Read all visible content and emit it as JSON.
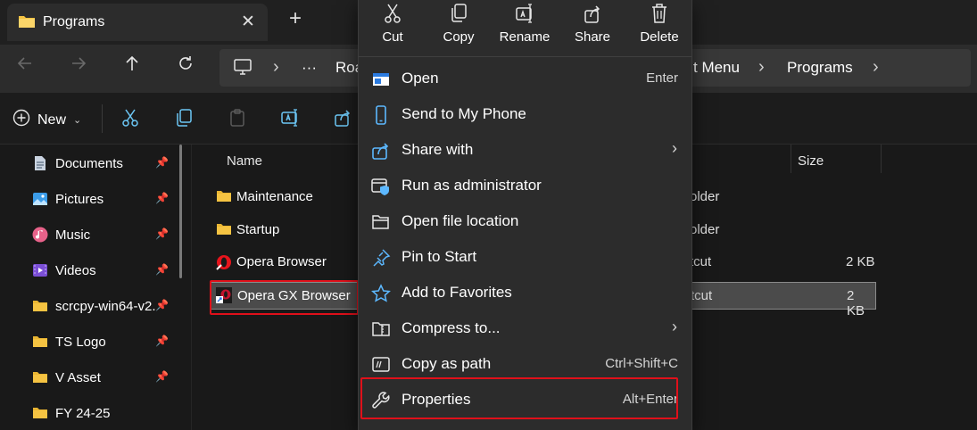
{
  "window": {
    "tab_title": "Programs",
    "tab_close": "✕",
    "new_tab": "+"
  },
  "address_bar": {
    "more": "···",
    "crumb_partial_left": "Roa",
    "crumb_partial_right": "t Menu",
    "crumb_current": "Programs",
    "separator": "›"
  },
  "command_bar": {
    "new_label": "New",
    "new_icon": "plus-circle-icon"
  },
  "sidebar": {
    "items": [
      {
        "label": "Documents",
        "icon": "documents-icon",
        "pinned": true
      },
      {
        "label": "Pictures",
        "icon": "pictures-icon",
        "pinned": true
      },
      {
        "label": "Music",
        "icon": "music-icon",
        "pinned": true
      },
      {
        "label": "Videos",
        "icon": "videos-icon",
        "pinned": true
      },
      {
        "label": "scrcpy-win64-v2.",
        "icon": "folder-icon",
        "pinned": true
      },
      {
        "label": "TS Logo",
        "icon": "folder-icon",
        "pinned": true
      },
      {
        "label": "V Asset",
        "icon": "folder-icon",
        "pinned": true
      },
      {
        "label": "FY 24-25",
        "icon": "folder-icon",
        "pinned": false
      }
    ]
  },
  "file_list": {
    "columns": {
      "name": "Name",
      "size": "Size"
    },
    "rows": [
      {
        "name": "Maintenance",
        "type": "older",
        "size": "",
        "icon": "folder-icon",
        "selected": false
      },
      {
        "name": "Startup",
        "type": "older",
        "size": "",
        "icon": "folder-icon",
        "selected": false
      },
      {
        "name": "Opera Browser",
        "type": "tcut",
        "size": "2 KB",
        "icon": "opera-icon",
        "selected": false
      },
      {
        "name": "Opera GX Browser",
        "type": "tcut",
        "size": "2 KB",
        "icon": "opera-gx-icon",
        "selected": true
      }
    ]
  },
  "context_menu": {
    "quick_actions": [
      {
        "label": "Cut",
        "icon": "scissors-icon"
      },
      {
        "label": "Copy",
        "icon": "copy-icon"
      },
      {
        "label": "Rename",
        "icon": "rename-icon"
      },
      {
        "label": "Share",
        "icon": "share-icon"
      },
      {
        "label": "Delete",
        "icon": "trash-icon"
      }
    ],
    "items": [
      {
        "label": "Open",
        "shortcut": "Enter",
        "icon": "open-app-icon"
      },
      {
        "label": "Send to My Phone",
        "shortcut": "",
        "icon": "phone-icon"
      },
      {
        "label": "Share with",
        "shortcut": "",
        "icon": "share-with-icon",
        "submenu": "›"
      },
      {
        "label": "Run as administrator",
        "shortcut": "",
        "icon": "shield-window-icon"
      },
      {
        "label": "Open file location",
        "shortcut": "",
        "icon": "folder-open-icon"
      },
      {
        "label": "Pin to Start",
        "shortcut": "",
        "icon": "pin-icon"
      },
      {
        "label": "Add to Favorites",
        "shortcut": "",
        "icon": "star-icon"
      },
      {
        "label": "Compress to...",
        "shortcut": "",
        "icon": "zip-icon",
        "submenu": "›"
      },
      {
        "label": "Copy as path",
        "shortcut": "Ctrl+Shift+C",
        "icon": "copy-path-icon"
      },
      {
        "label": "Properties",
        "shortcut": "Alt+Enter",
        "icon": "wrench-icon"
      }
    ]
  },
  "colors": {
    "highlight_outline": "#e0101a",
    "accent": "#4cc2ff",
    "folder": "#f5c342"
  }
}
